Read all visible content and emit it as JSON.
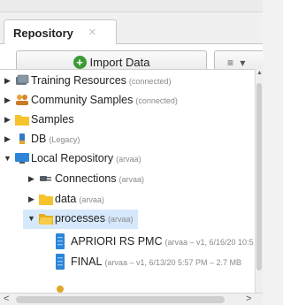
{
  "panel": {
    "tab_label": "Repository",
    "tab_close": "×"
  },
  "toolbar": {
    "import_label": "Import Data",
    "menu_glyph": "≡ ▾"
  },
  "tree": {
    "items": [
      {
        "label": "Training Resources",
        "sub": "(connected)",
        "icon": "training-resources-icon",
        "expanded": false
      },
      {
        "label": "Community Samples",
        "sub": "(connected)",
        "icon": "community-icon",
        "expanded": false
      },
      {
        "label": "Samples",
        "sub": "",
        "icon": "folder-icon",
        "expanded": false
      },
      {
        "label": "DB",
        "sub": "(Legacy)",
        "icon": "database-icon",
        "expanded": false
      },
      {
        "label": "Local Repository",
        "sub": "(arvaa)",
        "icon": "local-repository-icon",
        "expanded": true
      },
      {
        "label": "Connections",
        "sub": "(arvaa)",
        "icon": "connections-icon",
        "expanded": false
      },
      {
        "label": "data",
        "sub": "(arvaa)",
        "icon": "folder-icon",
        "expanded": false
      },
      {
        "label": "processes",
        "sub": "(arvaa)",
        "icon": "folder-open-icon",
        "expanded": true,
        "selected": true
      },
      {
        "label": "APRIORI RS PMC",
        "sub": "(arvaa – v1, 6/16/20 10:5",
        "icon": "process-file-icon"
      },
      {
        "label": "FINAL",
        "sub": "(arvaa – v1, 6/13/20 5:57 PM – 2.7 MB",
        "icon": "process-file-icon"
      }
    ]
  },
  "colors": {
    "folder": "#f5c32c",
    "selected_bg": "#d6e8fb",
    "accent_green": "#3a9b35",
    "file_blue": "#2b86d8"
  }
}
